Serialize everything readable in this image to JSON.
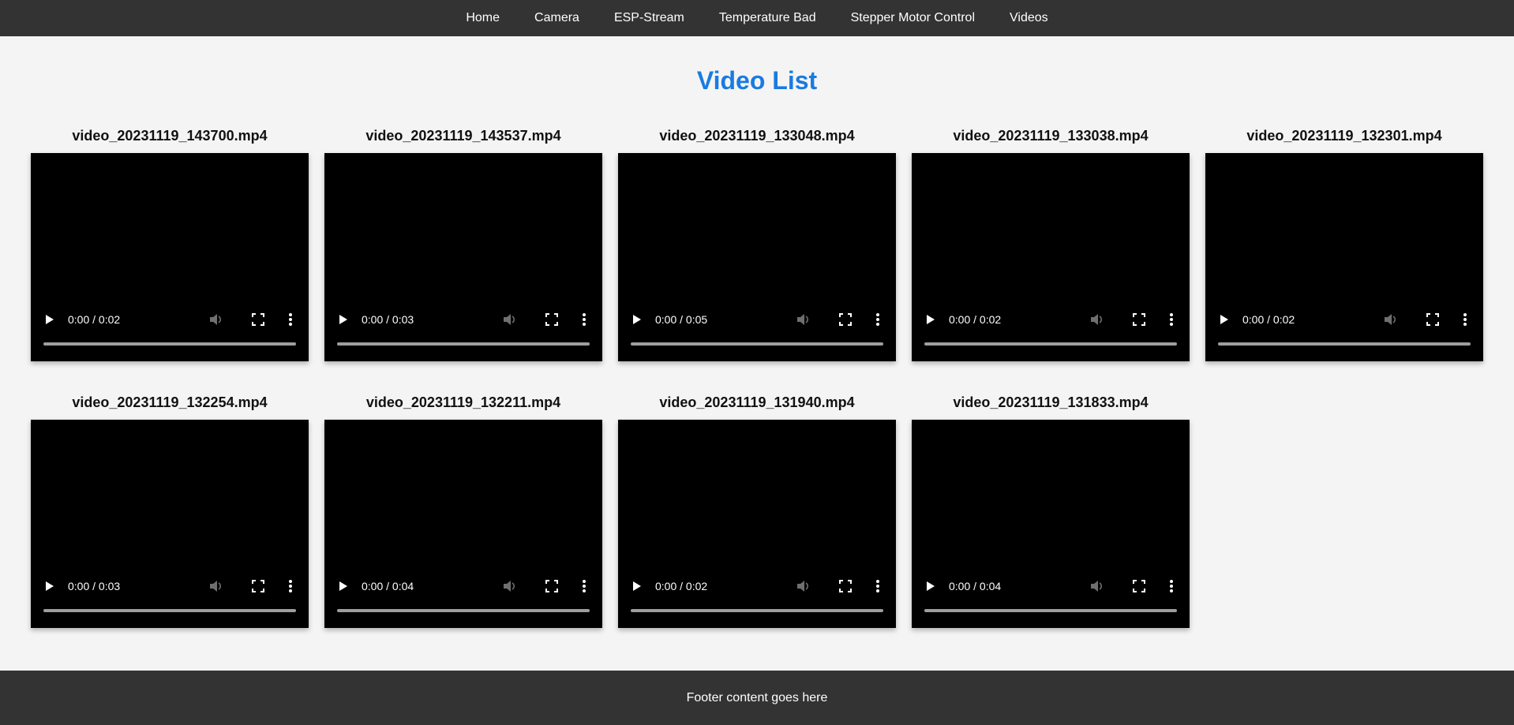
{
  "nav": {
    "items": [
      {
        "label": "Home"
      },
      {
        "label": "Camera"
      },
      {
        "label": "ESP-Stream"
      },
      {
        "label": "Temperature Bad"
      },
      {
        "label": "Stepper Motor Control"
      },
      {
        "label": "Videos"
      }
    ]
  },
  "page": {
    "title": "Video List"
  },
  "videos": [
    {
      "filename": "video_20231119_143700.mp4",
      "time": "0:00 / 0:02"
    },
    {
      "filename": "video_20231119_143537.mp4",
      "time": "0:00 / 0:03"
    },
    {
      "filename": "video_20231119_133048.mp4",
      "time": "0:00 / 0:05"
    },
    {
      "filename": "video_20231119_133038.mp4",
      "time": "0:00 / 0:02"
    },
    {
      "filename": "video_20231119_132301.mp4",
      "time": "0:00 / 0:02"
    },
    {
      "filename": "video_20231119_132254.mp4",
      "time": "0:00 / 0:03"
    },
    {
      "filename": "video_20231119_132211.mp4",
      "time": "0:00 / 0:04"
    },
    {
      "filename": "video_20231119_131940.mp4",
      "time": "0:00 / 0:02"
    },
    {
      "filename": "video_20231119_131833.mp4",
      "time": "0:00 / 0:04"
    }
  ],
  "footer": {
    "text": "Footer content goes here"
  },
  "colors": {
    "nav_bg": "#333333",
    "title": "#1a7be0",
    "page_bg": "#f4f4f4",
    "player_bg": "#000000"
  },
  "icons": {
    "play": "play-icon",
    "volume": "volume-icon",
    "fullscreen": "fullscreen-icon",
    "more": "more-options-icon"
  }
}
